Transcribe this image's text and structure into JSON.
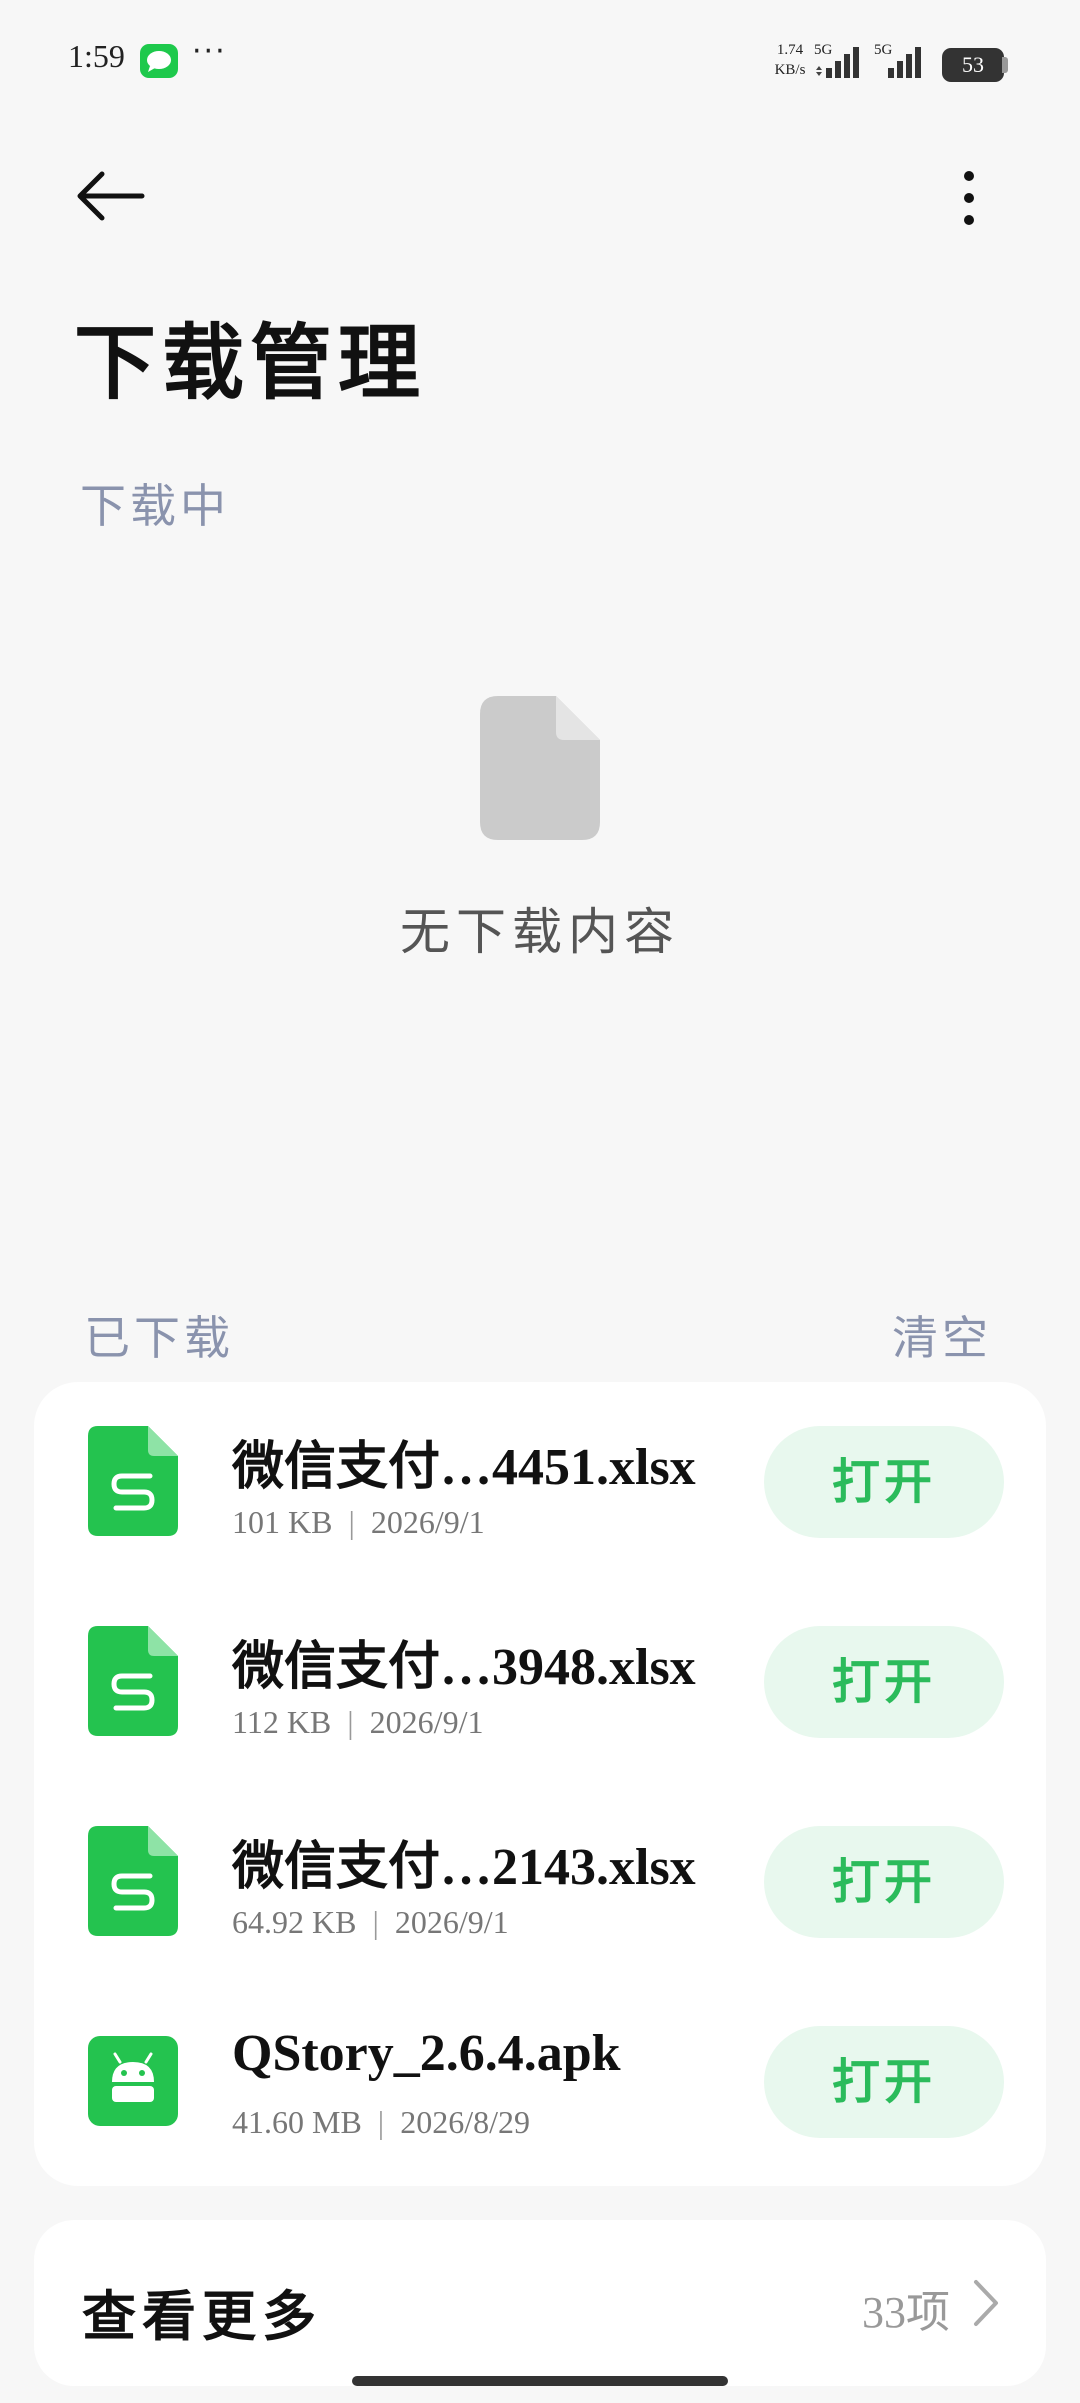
{
  "status": {
    "time": "1:59",
    "speed_top": "1.74",
    "speed_bottom": "KB/s",
    "sim1": "5G",
    "sim2": "5G",
    "battery": "53"
  },
  "header": {
    "title": "下载管理"
  },
  "downloading": {
    "label": "下载中",
    "empty_text": "无下载内容"
  },
  "downloaded": {
    "label": "已下载",
    "clear": "清空",
    "items": [
      {
        "name": "微信支付…4451.xlsx",
        "size": "101 KB",
        "date": "2026/9/1",
        "open": "打开",
        "icon": "spreadsheet-icon"
      },
      {
        "name": "微信支付…3948.xlsx",
        "size": "112 KB",
        "date": "2026/9/1",
        "open": "打开",
        "icon": "spreadsheet-icon"
      },
      {
        "name": "微信支付…2143.xlsx",
        "size": "64.92 KB",
        "date": "2026/9/1",
        "open": "打开",
        "icon": "spreadsheet-icon"
      },
      {
        "name": "QStory_2.6.4.apk",
        "size": "41.60 MB",
        "date": "2026/8/29",
        "open": "打开",
        "icon": "android-icon"
      }
    ],
    "separator": "|"
  },
  "more": {
    "label": "查看更多",
    "count": "33项"
  },
  "colors": {
    "accent_green": "#2bbb5b",
    "button_bg": "#e8f8ee",
    "section_label": "#8a93ad"
  }
}
